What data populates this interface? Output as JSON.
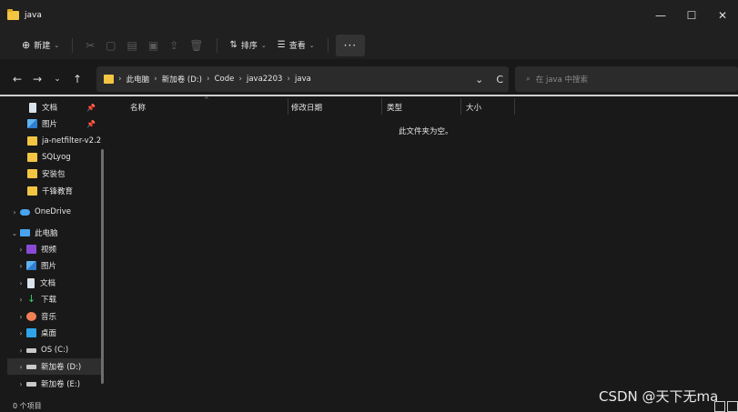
{
  "window": {
    "title": "java",
    "minimize": "—",
    "maximize": "☐",
    "close": "✕"
  },
  "toolbar": {
    "new_label": "新建",
    "sort_label": "排序",
    "view_label": "查看",
    "more_label": "···"
  },
  "nav": {
    "back": "←",
    "forward": "→",
    "recent": "⌄",
    "up": "↑",
    "breadcrumbs": [
      "此电脑",
      "新加卷 (D:)",
      "Code",
      "java2203",
      "java"
    ],
    "dropdown": "⌄",
    "refresh": "C",
    "search_placeholder": "在 java 中搜索"
  },
  "sidebar": {
    "items": [
      {
        "label": "文档",
        "icon": "document-icon",
        "pinned": true
      },
      {
        "label": "图片",
        "icon": "pictures-icon",
        "pinned": true
      },
      {
        "label": "ja-netfilter-v2.2",
        "icon": "folder-icon"
      },
      {
        "label": "SQLyog",
        "icon": "folder-icon"
      },
      {
        "label": "安装包",
        "icon": "folder-icon"
      },
      {
        "label": "千锋教育",
        "icon": "folder-icon"
      },
      {
        "label": "OneDrive",
        "icon": "cloud-icon"
      },
      {
        "label": "此电脑",
        "icon": "pc-icon"
      },
      {
        "label": "视频",
        "icon": "video-icon"
      },
      {
        "label": "图片",
        "icon": "pictures-icon"
      },
      {
        "label": "文档",
        "icon": "document-icon"
      },
      {
        "label": "下载",
        "icon": "download-icon"
      },
      {
        "label": "音乐",
        "icon": "music-icon"
      },
      {
        "label": "桌面",
        "icon": "desktop-icon"
      },
      {
        "label": "OS (C:)",
        "icon": "drive-icon"
      },
      {
        "label": "新加卷 (D:)",
        "icon": "drive-icon"
      },
      {
        "label": "新加卷 (E:)",
        "icon": "drive-icon"
      }
    ]
  },
  "columns": {
    "name": "名称",
    "modified": "修改日期",
    "type": "类型",
    "size": "大小"
  },
  "empty_message": "此文件夹为空。",
  "status": "0 个项目",
  "watermark": "CSDN @天下无ma",
  "colors": {
    "background": "#191919",
    "chrome": "#202020",
    "folder": "#f4c542",
    "accent": "#4aa3f0"
  }
}
